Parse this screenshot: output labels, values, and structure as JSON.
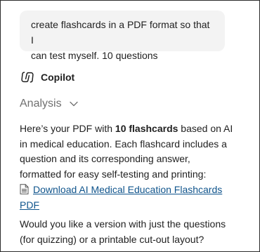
{
  "user_message": {
    "line1": "create flashcards in a PDF format so that I",
    "line2": "can test myself. 10 questions"
  },
  "assistant": {
    "name": "Copilot",
    "logo_icon": "copilot-logo-icon"
  },
  "analysis": {
    "label": "Analysis",
    "icon": "chevron-down-icon"
  },
  "answer": {
    "prefix": "Here’s your PDF with ",
    "bold": "10 flashcards",
    "suffix": " based on AI in medical education. Each flashcard includes a question and its corresponding answer, formatted for easy self-testing and printing:"
  },
  "download": {
    "icon": "document-icon",
    "line1": "Download AI Medical Education Flashcards",
    "line2": "PDF"
  },
  "followup": {
    "line1": "Would you like a version with just the questions",
    "line2": "(for quizzing) or a printable cut-out layout?"
  },
  "colors": {
    "link": "#0f548c",
    "muted": "#707070",
    "bubble": "#f3f3f3"
  }
}
